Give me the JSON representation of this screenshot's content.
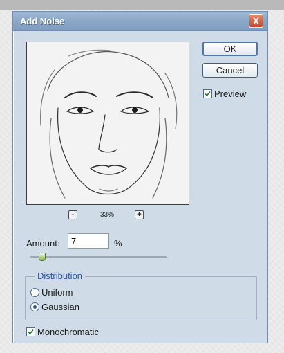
{
  "dialog": {
    "title": "Add Noise",
    "close_glyph": "X",
    "buttons": {
      "ok": "OK",
      "cancel": "Cancel"
    },
    "preview_checkbox": {
      "label": "Preview",
      "checked": true
    },
    "zoom": {
      "minus": "-",
      "plus": "+",
      "level": "33%"
    },
    "amount": {
      "label": "Amount:",
      "value": "7",
      "unit": "%",
      "slider_fraction": 0.07
    },
    "distribution": {
      "legend": "Distribution",
      "options": [
        {
          "label": "Uniform",
          "selected": false
        },
        {
          "label": "Gaussian",
          "selected": true
        }
      ]
    },
    "monochromatic": {
      "label": "Monochromatic",
      "checked": true
    }
  },
  "colors": {
    "dialog_bg": "#cfdce8",
    "titlebar": "#8aa6c6",
    "close_red": "#c9452a",
    "legend_blue": "#2d57a8"
  },
  "icons": [
    "close-icon",
    "zoom-out-icon",
    "zoom-in-icon",
    "checkmark-icon",
    "slider-thumb-icon"
  ]
}
